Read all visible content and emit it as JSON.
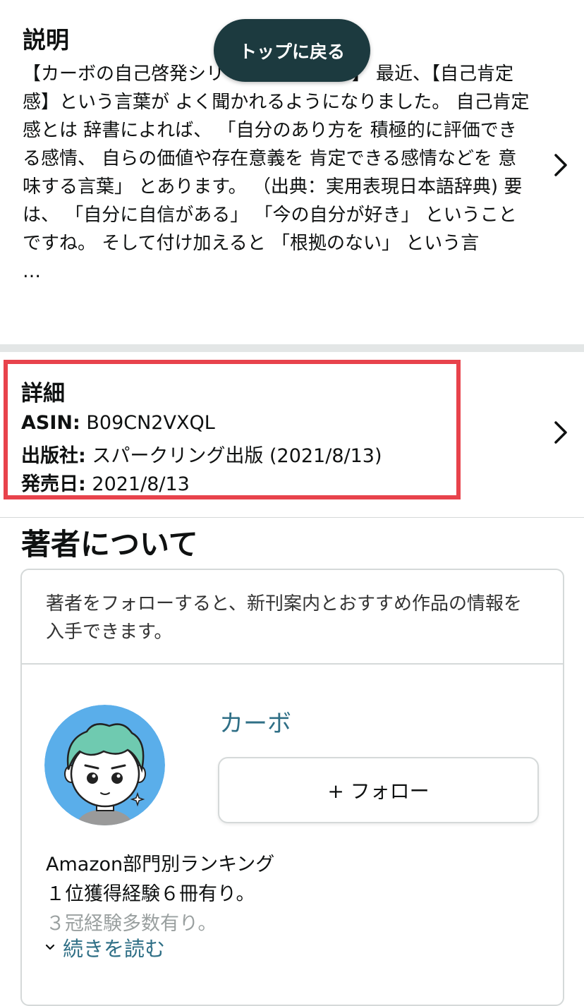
{
  "description": {
    "title": "説明",
    "body": "【カーボの自己啓発シリーズ〜番外さん】 最近、【自己肯定感】という言葉が よく聞かれるようになりました。 自己肯定感とは 辞書によれば、 「自分のあり方を 積極的に評価できる感情、 自らの価値や存在意義を 肯定できる感情などを 意味する言葉」 とあります。 （出典：実用表現日本語辞典) 要は、 「自分に自信がある」 「今の自分が好き」 ということですね。 そして付け加えると 「根拠のない」 という言",
    "ellipsis": "…",
    "chevron_icon": "chevron-right-icon"
  },
  "top_button": {
    "label": "トップに戻る"
  },
  "details": {
    "title": "詳細",
    "rows": [
      {
        "label": "ASIN:",
        "value": " B09CN2VXQL"
      },
      {
        "label": "出版社:",
        "value": " スパークリング出版 (2021/8/13)"
      },
      {
        "label": "発売日:",
        "value": " 2021/8/13"
      }
    ],
    "chevron_icon": "chevron-right-icon",
    "highlight_color": "#e8434c"
  },
  "about_author": {
    "title": "著者について",
    "follow_note": "著者をフォローすると、新刊案内とおすすめ作品の情報を入手できます。",
    "author_name": "カーボ",
    "follow_button": "+ フォロー",
    "bio_lines": [
      "Amazon部門別ランキング",
      "１位獲得経験６冊有り。"
    ],
    "bio_faded": "３冠経験多数有り。",
    "read_more": "続きを読む",
    "link_color": "#2f6f86"
  }
}
